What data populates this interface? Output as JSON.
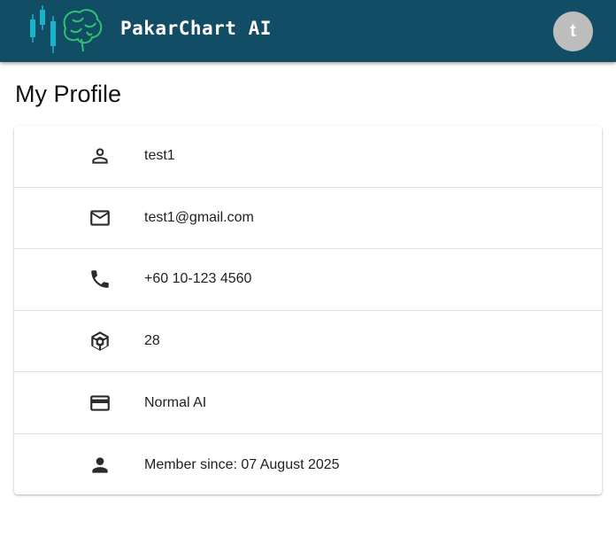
{
  "header": {
    "brand": "PakarChart AI",
    "avatar_initial": "t",
    "bg_color": "#124d66"
  },
  "page": {
    "title": "My Profile"
  },
  "profile": {
    "rows": [
      {
        "icon": "account-outline-icon",
        "value": "test1"
      },
      {
        "icon": "email-outline-icon",
        "value": "test1@gmail.com"
      },
      {
        "icon": "phone-icon",
        "value": "+60 10-123 4560"
      },
      {
        "icon": "cube-icon",
        "value": "28"
      },
      {
        "icon": "credit-card-icon",
        "value": "Normal AI"
      },
      {
        "icon": "person-icon",
        "value": "Member since: 07 August 2025"
      }
    ]
  }
}
